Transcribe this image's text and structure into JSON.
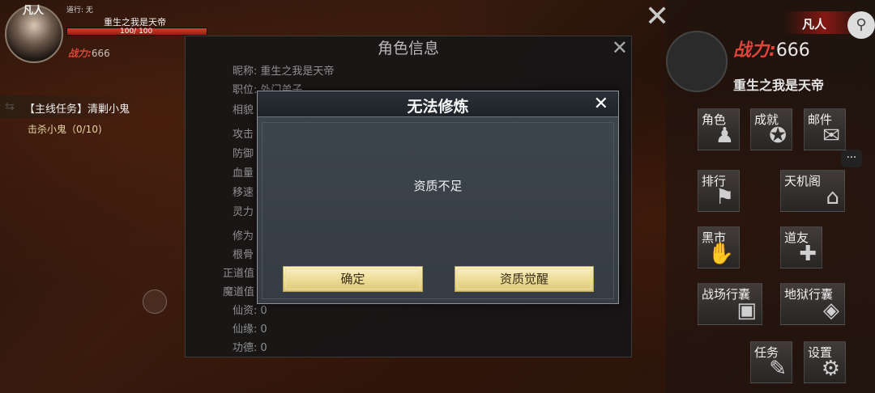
{
  "player": {
    "rank": "凡人",
    "dao": "道行: 无",
    "name": "重生之我是天帝",
    "hp_text": "100/ 100",
    "hp_fraction": 1.0,
    "power_label": "战力:",
    "power_value": "666"
  },
  "quest": {
    "title": "【主线任务】清剿小鬼",
    "objective": "击杀小鬼（0/10)"
  },
  "info_panel": {
    "title": "角色信息",
    "close": "✕",
    "rows": [
      {
        "label": "昵称:",
        "value": "重生之我是天帝"
      },
      {
        "label": "职位:",
        "value": "外门弟子"
      },
      {
        "label": "相貌",
        "value": ""
      },
      {
        "label": "攻击",
        "value": ""
      },
      {
        "label": "防御",
        "value": ""
      },
      {
        "label": "血量",
        "value": ""
      },
      {
        "label": "移速",
        "value": ""
      },
      {
        "label": "灵力",
        "value": ""
      },
      {
        "label": "修为",
        "value": ""
      },
      {
        "label": "根骨",
        "value": ""
      },
      {
        "label": "正道值",
        "value": ""
      },
      {
        "label": "魔道值",
        "value": ""
      },
      {
        "label": "仙资:",
        "value": "0"
      },
      {
        "label": "仙缘:",
        "value": "0"
      },
      {
        "label": "功德:",
        "value": "0"
      }
    ]
  },
  "modal": {
    "title": "无法修炼",
    "close": "✕",
    "message": "资质不足",
    "confirm_label": "确定",
    "awaken_label": "资质觉醒"
  },
  "right_panel": {
    "rank": "凡人",
    "power_label": "战力:",
    "power_value": "666",
    "name": "重生之我是天帝",
    "menu": [
      {
        "label": "角色",
        "icon": "silhouette-icon"
      },
      {
        "label": "成就",
        "icon": "medal-icon"
      },
      {
        "label": "邮件",
        "icon": "envelope-icon"
      },
      {
        "label": "排行",
        "icon": "banner-icon"
      },
      {
        "label": "天机阁",
        "icon": "pavilion-icon"
      },
      {
        "label": "黑市",
        "icon": "hand-icon"
      },
      {
        "label": "道友",
        "icon": "friends-icon"
      },
      {
        "label": "战场行囊",
        "icon": "backpack-icon"
      },
      {
        "label": "地狱行囊",
        "icon": "hell-pack-icon"
      },
      {
        "label": "任务",
        "icon": "scroll-icon"
      },
      {
        "label": "设置",
        "icon": "gear-icon"
      }
    ]
  }
}
